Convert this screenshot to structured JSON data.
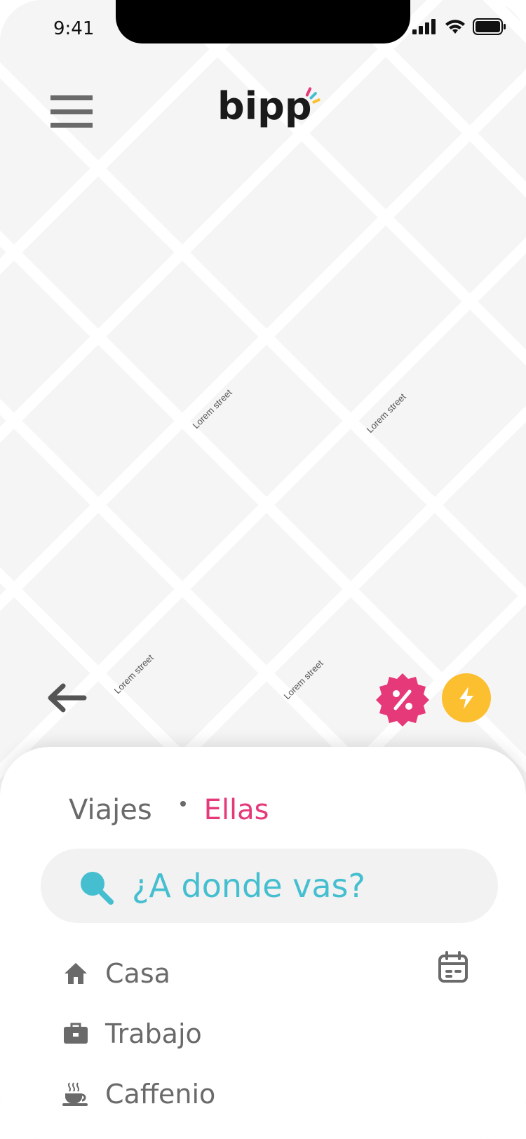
{
  "status_bar": {
    "time": "9:41"
  },
  "header": {
    "logo_text": "bipp"
  },
  "map": {
    "street_labels": [
      "Lorem street",
      "Lorem street",
      "Lorem street",
      "Lorem street"
    ]
  },
  "sheet": {
    "tabs": [
      {
        "label": "Viajes"
      },
      {
        "label": "Ellas",
        "active": true
      }
    ],
    "search": {
      "placeholder": "¿A donde vas?"
    },
    "places": [
      {
        "label": "Casa",
        "icon": "home-icon"
      },
      {
        "label": "Trabajo",
        "icon": "briefcase-icon"
      },
      {
        "label": "Caffenio",
        "icon": "coffee-cup-icon"
      }
    ],
    "calendar_icon": "calendar-icon"
  },
  "colors": {
    "accent_pink": "#e5397a",
    "accent_yellow": "#fbbf2f",
    "accent_cyan": "#45bfd0",
    "text_gray": "#6a6a6a",
    "map_bg": "#f6f5f5"
  }
}
